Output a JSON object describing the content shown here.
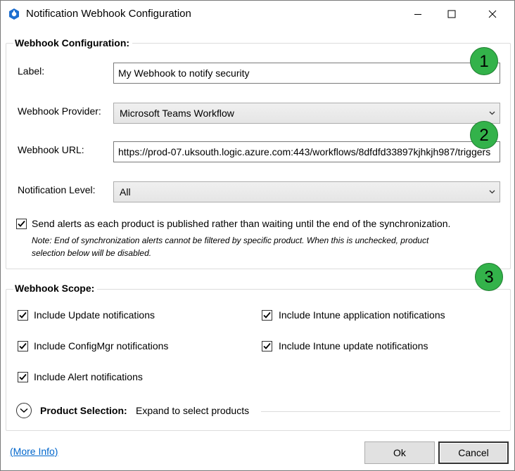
{
  "window": {
    "title": "Notification Webhook Configuration",
    "minimize_label": "Minimize",
    "maximize_label": "Maximize",
    "close_label": "Close"
  },
  "config": {
    "header": "Webhook Configuration:",
    "label": {
      "label": "Label:",
      "value": "My Webhook to notify security"
    },
    "provider": {
      "label": "Webhook Provider:",
      "value": "Microsoft Teams Workflow"
    },
    "url": {
      "label": "Webhook URL:",
      "value": "https://prod-07.uksouth.logic.azure.com:443/workflows/8dfdfd33897kjhkjh987/triggers"
    },
    "level": {
      "label": "Notification Level:",
      "value": "All"
    },
    "send_alerts": {
      "label": "Send alerts as each product is published rather than waiting until the end of the synchronization.",
      "checked": true,
      "note_line1": "Note: End of synchronization alerts cannot be filtered by specific product. When this is unchecked, product",
      "note_line2": "selection below will be disabled."
    }
  },
  "scope": {
    "header": "Webhook Scope:",
    "options": [
      {
        "label": "Include Update notifications",
        "checked": true
      },
      {
        "label": "Include Intune application notifications",
        "checked": true
      },
      {
        "label": "Include ConfigMgr notifications",
        "checked": true
      },
      {
        "label": "Include Intune update notifications",
        "checked": true
      },
      {
        "label": "Include Alert notifications",
        "checked": true
      }
    ],
    "product_selection": {
      "label": "Product Selection:",
      "hint": "Expand to select products"
    }
  },
  "badges": [
    "1",
    "2",
    "3"
  ],
  "footer": {
    "more_info": "(More Info)",
    "ok": "Ok",
    "cancel": "Cancel"
  },
  "colors": {
    "badge": "#33b24a",
    "link": "#0066cc"
  }
}
